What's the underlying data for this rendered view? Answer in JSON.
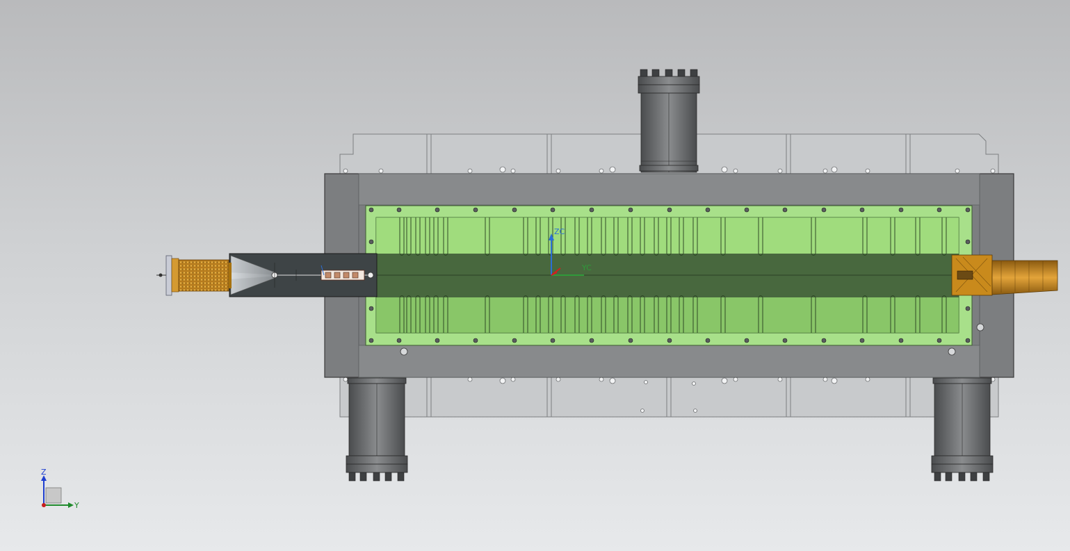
{
  "viewport": {
    "background_top": "#b9babc",
    "background_bottom": "#e7e9eb"
  },
  "model": {
    "housing_color": "#7c7e80",
    "cavity_color": "#a8e08a",
    "inner_chamber_color": "#8fcf6b",
    "beam_pipe_color": "#3f5a38",
    "port_color": "#5f6163",
    "coil_color": "#d99a2b",
    "horn_color": "#c98a1c",
    "back_plate_color": "#c4c6c8"
  },
  "csys": {
    "zc_label": "ZC",
    "yc_label": "YC",
    "xc_color": "#d02020",
    "yc_color": "#2f9a3a",
    "zc_color": "#2b6fd6"
  },
  "triad": {
    "z_label": "Z",
    "y_label": "Y",
    "z_color": "#1f3fd0",
    "y_color": "#1f8a2c",
    "origin_color": "#c81e1e"
  }
}
